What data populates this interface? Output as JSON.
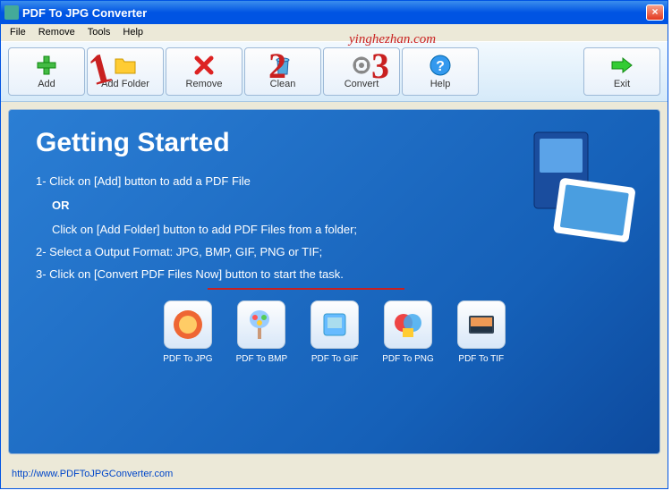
{
  "window": {
    "title": "PDF To JPG Converter"
  },
  "menu": {
    "file": "File",
    "remove": "Remove",
    "tools": "Tools",
    "help": "Help"
  },
  "toolbar": {
    "add": "Add",
    "addfolder": "Add Folder",
    "remove": "Remove",
    "clean": "Clean",
    "convert": "Convert",
    "help": "Help",
    "exit": "Exit"
  },
  "content": {
    "heading": "Getting Started",
    "step1": "1- Click on [Add] button to add a PDF File",
    "or": "OR",
    "step1b": "Click on [Add Folder] button to add PDF Files from a folder;",
    "step2": "2- Select a Output Format: JPG, BMP, GIF, PNG or TIF;",
    "step3": "3- Click on [Convert PDF Files Now] button to start the task."
  },
  "formats": {
    "jpg": "PDF To JPG",
    "bmp": "PDF To BMP",
    "gif": "PDF To GIF",
    "png": "PDF To PNG",
    "tif": "PDF To TIF"
  },
  "footer": {
    "link": "http://www.PDFToJPGConverter.com"
  },
  "watermark": "yinghezhan.com",
  "annotations": {
    "n1": "1",
    "n2": "2",
    "n3": "3"
  }
}
